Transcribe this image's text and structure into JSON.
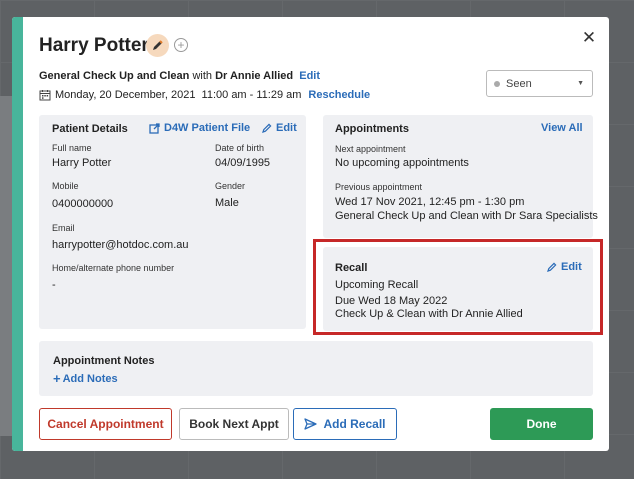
{
  "patient": {
    "name": "Harry Potter"
  },
  "appointment": {
    "type": "General Check Up and Clean",
    "with_text": "with",
    "provider": "Dr Annie Allied",
    "edit_label": "Edit",
    "datetime": "Monday, 20 December, 2021  11:00 am - 11:29 am",
    "reschedule_label": "Reschedule"
  },
  "status": {
    "value": "Seen"
  },
  "patient_details": {
    "title": "Patient Details",
    "d4w_link": "D4W Patient File",
    "edit_label": "Edit",
    "full_name_label": "Full name",
    "full_name": "Harry Potter",
    "dob_label": "Date of birth",
    "dob": "04/09/1995",
    "mobile_label": "Mobile",
    "mobile": "0400000000",
    "gender_label": "Gender",
    "gender": "Male",
    "email_label": "Email",
    "email": "harrypotter@hotdoc.com.au",
    "home_phone_label": "Home/alternate phone number",
    "home_phone": "-"
  },
  "appointments_panel": {
    "title": "Appointments",
    "view_all_label": "View All",
    "next_label": "Next appointment",
    "next_value": "No upcoming appointments",
    "previous_label": "Previous appointment",
    "previous_datetime": "Wed 17 Nov 2021, 12:45 pm - 1:30 pm",
    "previous_desc": "General Check Up and Clean with Dr Sara Specialists"
  },
  "recall_panel": {
    "title": "Recall",
    "edit_label": "Edit",
    "status": "Upcoming Recall",
    "due": "Due Wed 18 May 2022",
    "desc": "Check Up & Clean with Dr Annie Allied"
  },
  "notes_panel": {
    "title": "Appointment Notes",
    "add_label": "Add Notes"
  },
  "footer": {
    "cancel_label": "Cancel Appointment",
    "book_label": "Book Next Appt",
    "add_recall_label": "Add Recall",
    "done_label": "Done"
  },
  "colors": {
    "accent": "#48b59b",
    "link": "#2b6cb8",
    "danger": "#c0392b",
    "success": "#2d9a56",
    "highlight": "#c62828"
  }
}
